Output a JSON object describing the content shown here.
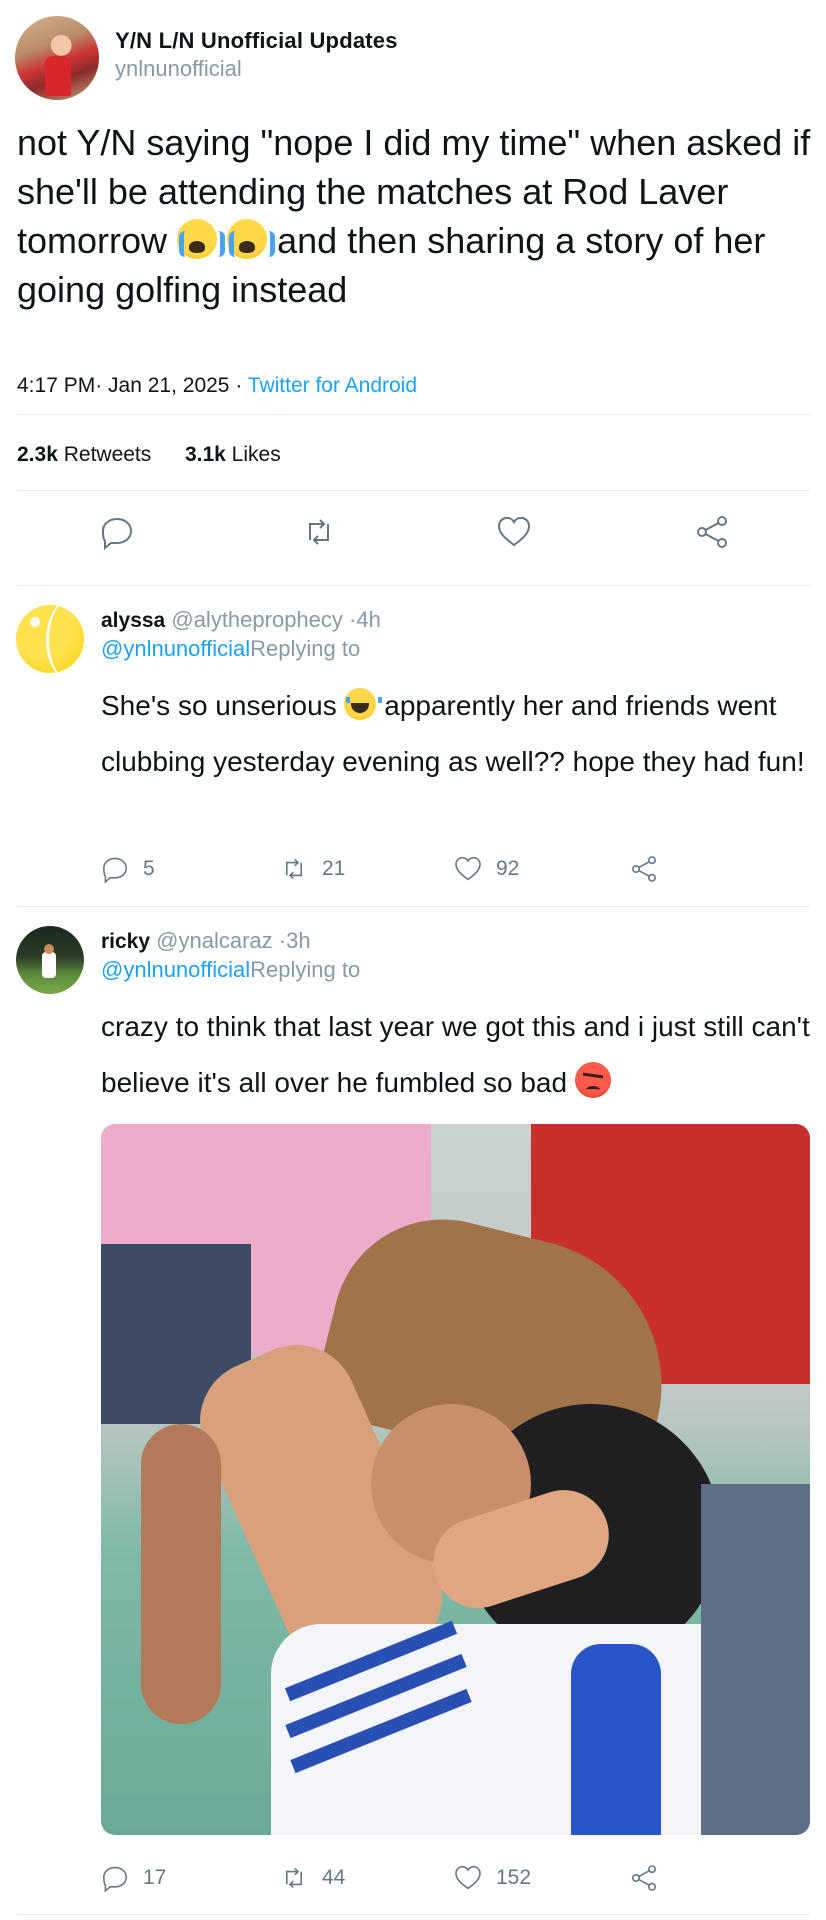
{
  "tweet": {
    "display_name": "Y/N L/N Unofficial Updates",
    "handle": "ynlnunofficial",
    "text_part1": "not Y/N saying \"nope I did my time\" when asked if she'll be attending the matches at Rod Laver tomorrow",
    "text_part2": "and then sharing a story of her going golfing instead",
    "time": "4:17 PM",
    "date": "Jan 21, 2025",
    "client": "Twitter for Android",
    "retweets": "2.3k",
    "retweets_label": "Retweets",
    "likes": "3.1k",
    "likes_label": "Likes"
  },
  "icons": {
    "reply": "reply-icon",
    "retweet": "retweet-icon",
    "like": "heart-icon",
    "share": "share-icon"
  },
  "replies": [
    {
      "name": "alyssa",
      "handle": "@alytheprophecy",
      "age": "4h",
      "reply_to_handle": "@ynlnunofficial",
      "reply_to_label": "Replying to",
      "text_part1": "She's so unserious",
      "text_part2": "apparently her and friends went clubbing yesterday evening as well?? hope they had fun!",
      "reply_count": "5",
      "retweet_count": "21",
      "like_count": "92"
    },
    {
      "name": "ricky",
      "handle": "@ynalcaraz",
      "age": "3h",
      "reply_to_handle": "@ynlnunofficial",
      "reply_to_label": "Replying to",
      "text_part1": "crazy to think that last year we got this and i just still can't believe it's all over he fumbled so bad",
      "reply_count": "17",
      "retweet_count": "44",
      "like_count": "152"
    }
  ],
  "colors": {
    "link": "#1da1f2",
    "muted": "#8899a6",
    "icon": "#657786",
    "divider": "#e6ecf0"
  }
}
